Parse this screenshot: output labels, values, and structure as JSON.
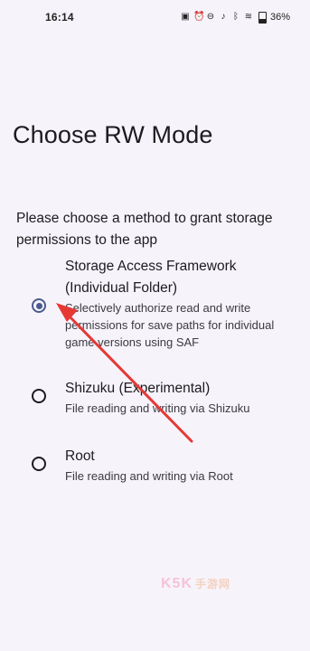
{
  "status_bar": {
    "time": "16:14",
    "battery": "36%",
    "icons": [
      "nfc-icon",
      "alarm-icon",
      "dnd-icon",
      "mute-icon",
      "bluetooth-icon",
      "wifi-icon",
      "battery-icon"
    ]
  },
  "page": {
    "title": "Choose RW Mode",
    "description": "Please choose a method to grant storage permissions to the app"
  },
  "options": [
    {
      "title": "Storage Access Framework (Individual Folder)",
      "description": "Selectively authorize read and write permissions for save paths for individual game versions using SAF",
      "selected": true
    },
    {
      "title": "Shizuku (Experimental)",
      "description": "File reading and writing via Shizuku",
      "selected": false
    },
    {
      "title": "Root",
      "description": "File reading and writing via Root",
      "selected": false
    }
  ],
  "colors": {
    "accent": "#4a5b8f",
    "background": "#f7f3fb",
    "annotation_arrow": "#e53935"
  },
  "watermark": {
    "brand": "K5K",
    "sub": "手游网"
  }
}
